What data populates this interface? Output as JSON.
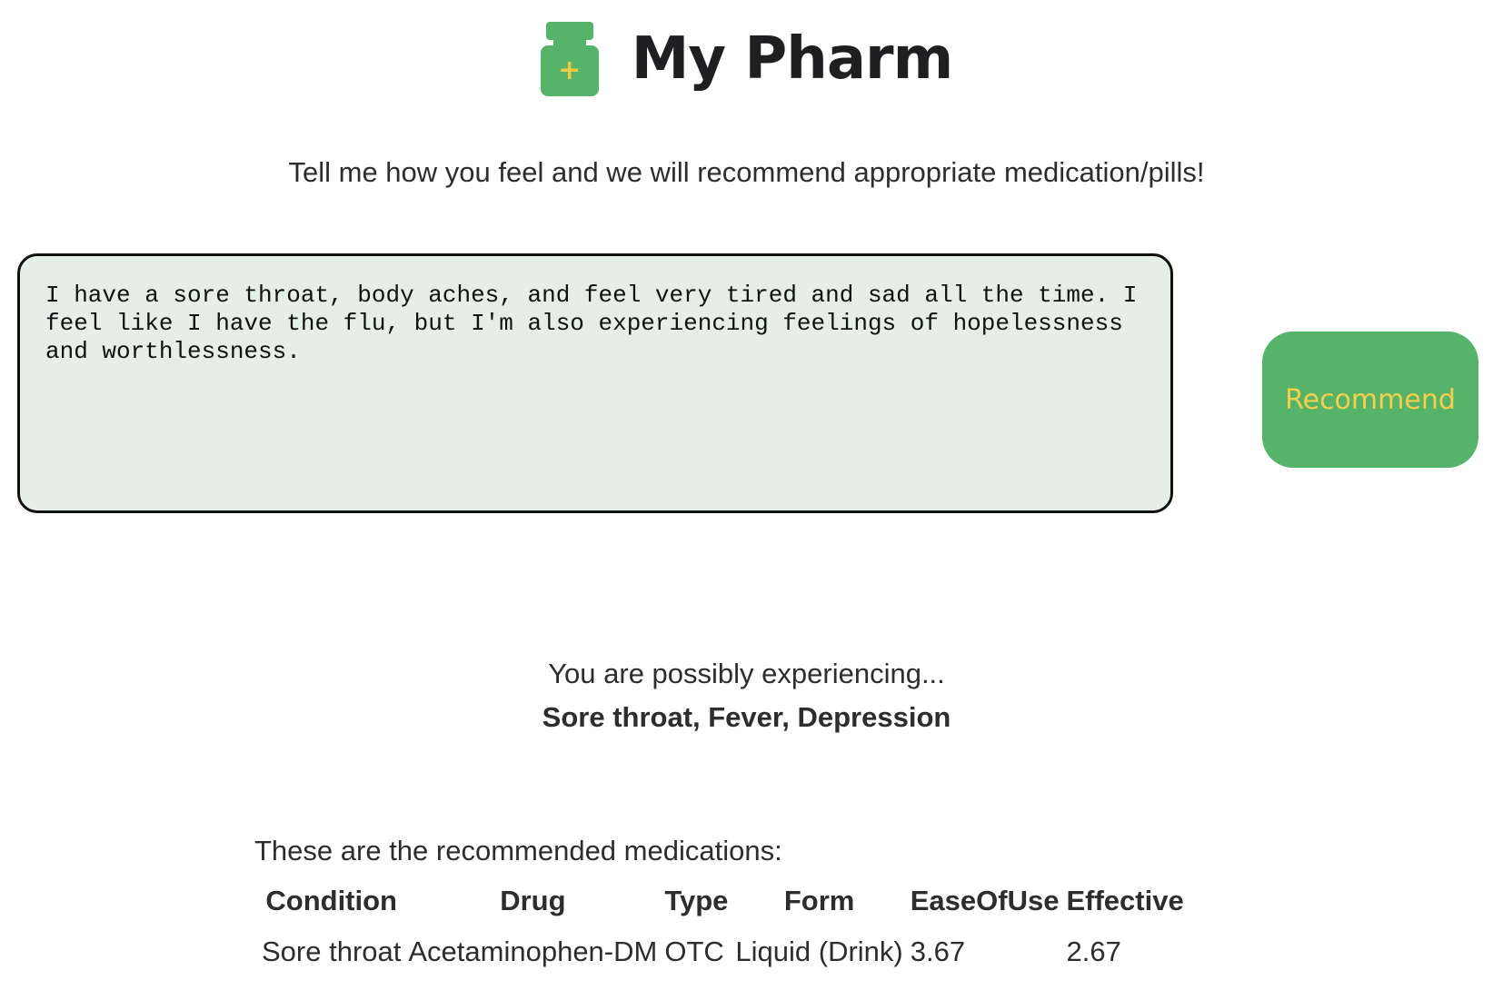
{
  "header": {
    "title": "My Pharm",
    "logo_icon": "medicine-bottle-icon"
  },
  "subtitle": "Tell me how you feel and we will recommend appropriate medication/pills!",
  "symptom_input": {
    "value": "I have a sore throat, body aches, and feel very tired and sad all the time. I feel like I have the flu, but I'm also experiencing feelings of hopelessness and worthlessness."
  },
  "recommend_button": {
    "label": "Recommend"
  },
  "diagnosis": {
    "intro": "You are possibly experiencing...",
    "conditions": "Sore throat, Fever, Depression"
  },
  "recommendations": {
    "intro": "These are the recommended medications:",
    "columns": [
      "Condition",
      "Drug",
      "Type",
      "Form",
      "EaseOfUse",
      "Effective"
    ],
    "rows": [
      [
        "Sore throat",
        "Acetaminophen-DM",
        "OTC",
        "Liquid (Drink)",
        "3.67",
        "2.67"
      ]
    ]
  },
  "colors": {
    "brand_green": "#55b36a",
    "accent_yellow": "#f7cf4a",
    "input_bg": "#e5efe8"
  }
}
